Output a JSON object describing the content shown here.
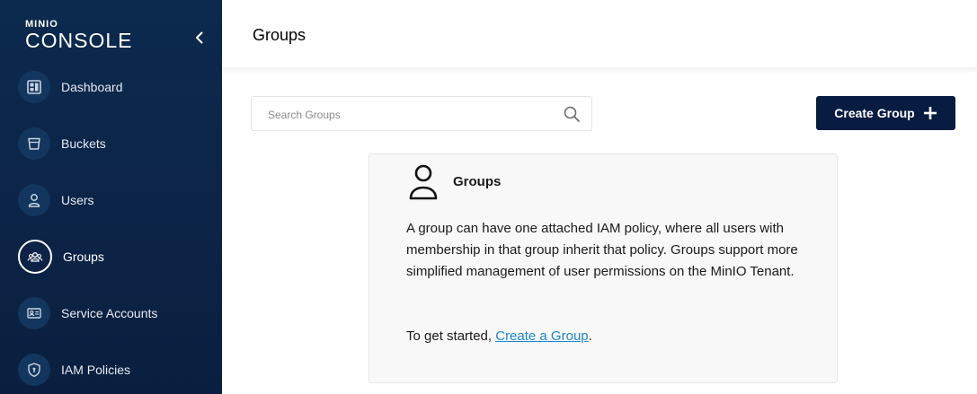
{
  "sidebar": {
    "logo_small": "MINIO",
    "logo_big": "CONSOLE",
    "items": [
      {
        "label": "Dashboard",
        "icon": "dashboard-icon"
      },
      {
        "label": "Buckets",
        "icon": "bucket-icon"
      },
      {
        "label": "Users",
        "icon": "user-icon"
      },
      {
        "label": "Groups",
        "icon": "groups-icon",
        "active": true
      },
      {
        "label": "Service Accounts",
        "icon": "id-card-icon"
      },
      {
        "label": "IAM Policies",
        "icon": "shield-icon"
      }
    ]
  },
  "header": {
    "title": "Groups"
  },
  "search": {
    "placeholder": "Search Groups",
    "value": ""
  },
  "toolbar": {
    "create_label": "Create Group"
  },
  "card": {
    "title": "Groups",
    "description": "A group can have one attached IAM policy, where all users with membership in that group inherit that policy. Groups support more simplified management of user permissions on the MinIO Tenant.",
    "cta_prefix": "To get started, ",
    "cta_link": "Create a Group",
    "cta_suffix": "."
  },
  "colors": {
    "sidebar_bg": "#0c2447",
    "primary_button": "#081c42",
    "link": "#1b87c9",
    "card_bg": "#f8f8f8"
  }
}
